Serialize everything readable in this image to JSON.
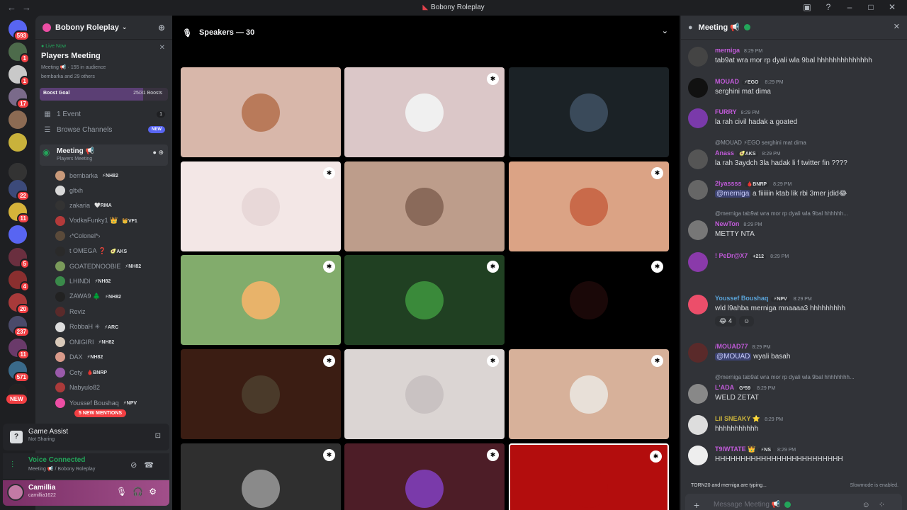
{
  "window": {
    "title": "Bobony Roleplay",
    "nav_back": "←",
    "nav_forward": "→"
  },
  "servers": [
    {
      "name": "Direct Messages",
      "color": "#5865f2",
      "badge": "593"
    },
    {
      "name": "Server 2",
      "color": "#4d6b4b",
      "badge": "1"
    },
    {
      "name": "Server 3",
      "color": "#c9c9c9",
      "badge": "1"
    },
    {
      "name": "Server 4",
      "color": "#7a6a8a",
      "badge": "17"
    },
    {
      "name": "Server 5",
      "color": "#8c6b53",
      "badge": ""
    },
    {
      "name": "Server 6",
      "color": "#c9b23b",
      "badge": ""
    },
    {
      "name": "DOPEBOYS",
      "color": "#333333",
      "badge": ""
    },
    {
      "name": "Server 8",
      "color": "#3c4a7a",
      "badge": "22"
    },
    {
      "name": "Server 9",
      "color": "#d6b33a",
      "badge": "11"
    },
    {
      "name": "Folder",
      "color": "#5865f2",
      "badge": ""
    },
    {
      "name": "Server 11",
      "color": "#6a2f3f",
      "badge": "5"
    },
    {
      "name": "Server 12",
      "color": "#8a2f2f",
      "badge": "4"
    },
    {
      "name": "Server 13",
      "color": "#a83a3a",
      "badge": "20"
    },
    {
      "name": "Server 14",
      "color": "#4a4a6a",
      "badge": "237"
    },
    {
      "name": "Server 15",
      "color": "#6a3a6a",
      "badge": "11"
    },
    {
      "name": "Server 16",
      "color": "#3a6a8a",
      "badge": "571"
    },
    {
      "name": "Server 17",
      "color": "#222222",
      "badge": ""
    }
  ],
  "server_new_label": "NEW",
  "sidebar": {
    "server_name": "Bobony Roleplay",
    "live": {
      "tag": "Live Now",
      "title": "Players Meeting",
      "channel": "Meeting 📢",
      "audience": "155 in audience",
      "people": "bembarka and 29 others"
    },
    "boost": {
      "label": "Boost Goal",
      "progress": "25/31 Boosts",
      "fraction": 0.806
    },
    "events": {
      "label": "1 Event",
      "count": "1"
    },
    "browse": {
      "label": "Browse Channels",
      "badge": "NEW"
    },
    "voice_channel": {
      "name": "Meeting 📢",
      "sub": "Players Meeting"
    },
    "members": [
      {
        "name": "bembarka",
        "tag": "⚡NH82",
        "color": "#c99a7a"
      },
      {
        "name": "gltxh",
        "tag": "",
        "color": "#d9d9d9"
      },
      {
        "name": "zakaria",
        "tag": "🤍RMA",
        "color": "#333333"
      },
      {
        "name": "VodkaFunky1 👑",
        "tag": "👑VF1",
        "color": "#b33a3a"
      },
      {
        "name": "‹*Colonel*›",
        "tag": "",
        "color": "#5a4a3a"
      },
      {
        "name": "t OMEGA ❓",
        "tag": "🥑AKS",
        "color": "#2a2a2a"
      },
      {
        "name": "GOATEDNOOBIE",
        "tag": "⚡NH82",
        "color": "#7a9a5a"
      },
      {
        "name": "LHINDI",
        "tag": "⚡NH82",
        "color": "#3a8a4a"
      },
      {
        "name": "ZAWA9 🌲",
        "tag": "⚡NH82",
        "color": "#222222"
      },
      {
        "name": "Reviz",
        "tag": "",
        "color": "#5a2a2a"
      },
      {
        "name": "RobbaH ✳",
        "tag": "⚡ARC",
        "color": "#dddddd"
      },
      {
        "name": "ONIGIRI",
        "tag": "⚡NH82",
        "color": "#d9c9b9"
      },
      {
        "name": "DAX",
        "tag": "⚡NH82",
        "color": "#d99a8a"
      },
      {
        "name": "Cety",
        "tag": "🩸BNRP",
        "color": "#9a5aaa"
      },
      {
        "name": "Nabyulo82",
        "tag": "",
        "color": "#aa3a3a"
      },
      {
        "name": "Youssef Boushaq",
        "tag": "⚡NPV",
        "color": "#ec4ea4"
      }
    ],
    "mentions_label": "5 NEW MENTIONS"
  },
  "game_assist": {
    "title": "Game Assist",
    "status": "Not Sharing"
  },
  "voice_connected": {
    "title": "Voice Connected",
    "sub": "Meeting 📢 / Bobony Roleplay"
  },
  "user": {
    "name": "Camillia",
    "handle": "camillia1622"
  },
  "stage": {
    "header": "Speakers — 30",
    "tiles": [
      {
        "bg": "#d8b7aa",
        "avatar": "#b97a5a",
        "mod": false
      },
      {
        "bg": "#dbc7c8",
        "avatar": "#f0f0f0",
        "mod": true
      },
      {
        "bg": "#1b2226",
        "avatar": "#3a4a5a",
        "mod": false
      },
      {
        "bg": "#f3e7e6",
        "avatar": "#e8d8d8",
        "mod": true
      },
      {
        "bg": "#bd9d8b",
        "avatar": "#8a6a5a",
        "mod": false
      },
      {
        "bg": "#dba385",
        "avatar": "#c96a4a",
        "mod": true
      },
      {
        "bg": "#82ac6c",
        "avatar": "#e8b36a",
        "mod": true
      },
      {
        "bg": "#204022",
        "avatar": "#3a8a3a",
        "mod": true
      },
      {
        "bg": "#000000",
        "avatar": "#1a0808",
        "mod": true
      },
      {
        "bg": "#3b1d13",
        "avatar": "#4a3a2a",
        "mod": true
      },
      {
        "bg": "#dbd5d3",
        "avatar": "#c9c2c2",
        "mod": true
      },
      {
        "bg": "#d7b19a",
        "avatar": "#e8e0d8",
        "mod": true
      },
      {
        "bg": "#2f2f2f",
        "avatar": "#8a8a8a",
        "mod": true
      },
      {
        "bg": "#4d1d27",
        "avatar": "#7a3aaa",
        "mod": true
      },
      {
        "bg": "#b30d0d",
        "avatar": "#b30d0d",
        "mod": true
      }
    ]
  },
  "chat": {
    "title": "Meeting 📢",
    "messages": [
      {
        "author": "merniga",
        "tag": "",
        "time": "8:29 PM",
        "text": "tab9at wra mor rp dyali wla 9bal hhhhhhhhhhhhhh",
        "color": "#c05ad8",
        "avatar": "#444"
      },
      {
        "author": "MOUAD",
        "tag": "⚡EGO",
        "time": "8:29 PM",
        "text": "serghini mat dima",
        "color": "#c05ad8",
        "avatar": "#111"
      },
      {
        "author": "FURRY",
        "tag": "",
        "time": "8:29 PM",
        "text": "la rah civil hadak a goated",
        "color": "#c05ad8",
        "avatar": "#7a3aaa"
      },
      {
        "reply": "@MOUAD ⚡EGO serghini mat dima",
        "author": "Anass",
        "tag": "🥑AKS",
        "time": "8:29 PM",
        "text": "la rah 3aydch 3la hadak li f twitter fin ????",
        "color": "#c05ad8",
        "avatar": "#555"
      },
      {
        "author": "2lyassss",
        "tag": "🩸BNRP",
        "time": "8:29 PM",
        "text": "a fiiiiiin ktab lik rbi 3mer jdid😂",
        "mention": "@merniga",
        "color": "#c05ad8",
        "avatar": "#666"
      },
      {
        "reply": "@merniga tab9at wra mor rp dyali wla 9bal hhhhhh...",
        "author": "NewTon",
        "tag": "",
        "time": "8:29 PM",
        "text": "METTY NTA",
        "color": "#c05ad8",
        "avatar": "#777"
      },
      {
        "author": "! PeDr@X7",
        "tag": "+212",
        "time": "8:29 PM",
        "text": "",
        "color": "#c05ad8",
        "avatar": "#8a3aaa"
      },
      {
        "author": "Youssef Boushaq",
        "tag": "⚡NPV",
        "time": "8:29 PM",
        "text": "wld l9ahba merniga mnaaaa3 hhhhhhhhh",
        "color": "#5aa3d8",
        "avatar": "#ec4e6a",
        "reaction": "😂 4"
      },
      {
        "author": "/MOUAD77",
        "tag": "",
        "time": "8:29 PM",
        "text": "wyali basah",
        "mention": "@MOUAD",
        "color": "#c05ad8",
        "avatar": "#5a2a2a"
      },
      {
        "reply": "@merniga tab9at wra mor rp dyali wla 9bal hhhhhhhh...",
        "author": "L'ADA",
        "tag": "G*59",
        "time": "8:29 PM",
        "text": "WELD ZETAT",
        "color": "#c05ad8",
        "avatar": "#888"
      },
      {
        "author": "Lil SNEAKY ⭐",
        "tag": "",
        "time": "8:29 PM",
        "text": "hhhhhhhhhhh",
        "color": "#c9b23b",
        "avatar": "#ddd"
      },
      {
        "author": "T9IWTATE 👑",
        "tag": "⚡NS",
        "time": "8:29 PM",
        "text": "HHHHHHHHHHHHHHHHHHHHHHHHH",
        "color": "#c05ad8",
        "avatar": "#eee"
      }
    ],
    "typing": "TORN20 and merniga are typing...",
    "slowmode": "Slowmode is enabled.",
    "placeholder": "Message Meeting 📢"
  }
}
